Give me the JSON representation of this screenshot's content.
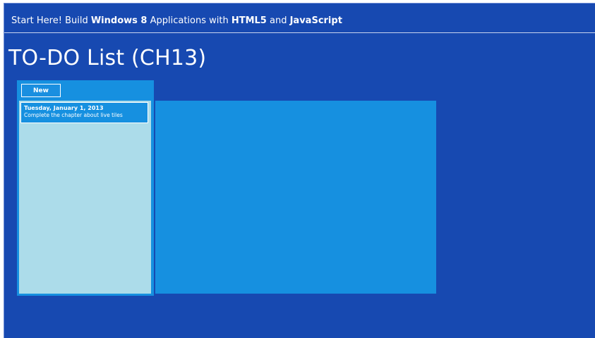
{
  "banner": {
    "part1": "Start Here! Build ",
    "bold1": "Windows 8",
    "part2": " Applications with ",
    "bold2": "HTML5",
    "part3": " and ",
    "bold3": "JavaScript"
  },
  "page": {
    "title": "TO-DO List (CH13)"
  },
  "toolbar": {
    "new_label": "New"
  },
  "todos": [
    {
      "date": "Tuesday, January 1, 2013",
      "text": "Complete the chapter about live tiles"
    }
  ],
  "colors": {
    "background": "#1749b1",
    "pane": "#1690e0",
    "list_background": "#acdcea",
    "text": "#ffffff"
  }
}
